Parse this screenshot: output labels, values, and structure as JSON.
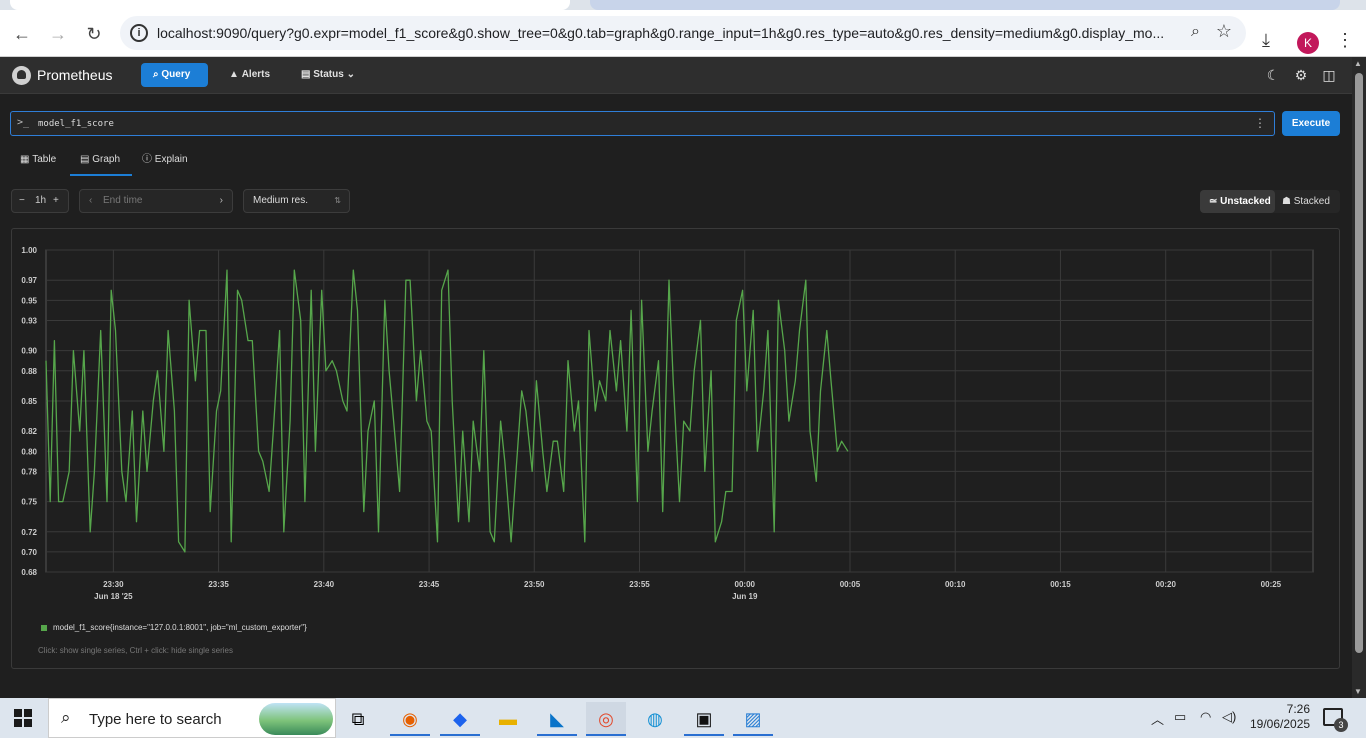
{
  "browser": {
    "url": "localhost:9090/query?g0.expr=model_f1_score&g0.show_tree=0&g0.tab=graph&g0.range_input=1h&g0.res_type=auto&g0.res_density=medium&g0.display_mo...",
    "profile_initial": "K"
  },
  "header": {
    "brand": "Prometheus",
    "nav": {
      "query": "Query",
      "alerts": "Alerts",
      "status": "Status"
    }
  },
  "query": {
    "prompt": ">_",
    "expression": "model_f1_score",
    "execute_label": "Execute"
  },
  "tabs": [
    {
      "label": "Table",
      "icon": "table-icon",
      "active": false
    },
    {
      "label": "Graph",
      "icon": "graph-icon",
      "active": true
    },
    {
      "label": "Explain",
      "icon": "info-icon",
      "active": false
    }
  ],
  "controls": {
    "range": "1h",
    "end_time_placeholder": "End time",
    "resolution": "Medium res.",
    "unstacked": "Unstacked",
    "stacked": "Stacked"
  },
  "chart_data": {
    "type": "line",
    "y_ticks": [
      "0.68",
      "0.70",
      "0.72",
      "0.75",
      "0.78",
      "0.80",
      "0.82",
      "0.85",
      "0.88",
      "0.90",
      "0.93",
      "0.95",
      "0.97",
      "1.00"
    ],
    "x_ticks": [
      {
        "label": "23:30",
        "sub": "Jun 18 '25"
      },
      {
        "label": "23:35",
        "sub": ""
      },
      {
        "label": "23:40",
        "sub": ""
      },
      {
        "label": "23:45",
        "sub": ""
      },
      {
        "label": "23:50",
        "sub": ""
      },
      {
        "label": "23:55",
        "sub": ""
      },
      {
        "label": "00:00",
        "sub": "Jun 19"
      },
      {
        "label": "00:05",
        "sub": ""
      },
      {
        "label": "00:10",
        "sub": ""
      },
      {
        "label": "00:15",
        "sub": ""
      },
      {
        "label": "00:20",
        "sub": ""
      },
      {
        "label": "00:25",
        "sub": ""
      }
    ],
    "ylim": [
      0.68,
      1.0
    ],
    "x_range_minutes_from_2330": [
      -3.2,
      57.0
    ],
    "series": [
      {
        "name": "model_f1_score{instance=\"127.0.0.1:8001\", job=\"ml_custom_exporter\"}",
        "color": "#56a64b",
        "x_minutes_from_2330": [
          -3.2,
          -3.0,
          -2.8,
          -2.6,
          -2.4,
          -2.1,
          -1.9,
          -1.6,
          -1.4,
          -1.1,
          -0.9,
          -0.6,
          -0.3,
          -0.1,
          0.1,
          0.4,
          0.6,
          0.9,
          1.1,
          1.4,
          1.6,
          1.9,
          2.1,
          2.4,
          2.6,
          2.9,
          3.1,
          3.4,
          3.6,
          3.9,
          4.1,
          4.4,
          4.6,
          4.9,
          5.1,
          5.4,
          5.6,
          5.9,
          6.1,
          6.4,
          6.6,
          6.9,
          7.1,
          7.4,
          7.6,
          7.9,
          8.1,
          8.4,
          8.6,
          8.9,
          9.1,
          9.4,
          9.6,
          9.9,
          10.1,
          10.4,
          10.6,
          10.9,
          11.1,
          11.4,
          11.6,
          11.9,
          12.1,
          12.4,
          12.6,
          12.9,
          13.1,
          13.4,
          13.6,
          13.9,
          14.1,
          14.4,
          14.6,
          14.9,
          15.1,
          15.4,
          15.6,
          15.9,
          16.1,
          16.4,
          16.6,
          16.9,
          17.1,
          17.4,
          17.6,
          17.9,
          18.1,
          18.4,
          18.6,
          18.9,
          19.1,
          19.4,
          19.6,
          19.9,
          20.1,
          20.4,
          20.6,
          20.9,
          21.1,
          21.4,
          21.6,
          21.9,
          22.1,
          22.4,
          22.6,
          22.9,
          23.1,
          23.4,
          23.6,
          23.9,
          24.1,
          24.4,
          24.6,
          24.9,
          25.1,
          25.4,
          25.6,
          25.9,
          26.1,
          26.4,
          26.6,
          26.9,
          27.1,
          27.4,
          27.6,
          27.9,
          28.1,
          28.4,
          28.6,
          28.9,
          29.1,
          29.4,
          29.6,
          29.9,
          30.1,
          30.4,
          30.6,
          30.9,
          31.1,
          31.4,
          31.6,
          31.9,
          32.1,
          32.4,
          32.6,
          32.9,
          33.1,
          33.4,
          33.6,
          33.9,
          34.1,
          34.4,
          34.6,
          34.9
        ],
        "values": [
          0.89,
          0.75,
          0.91,
          0.75,
          0.75,
          0.78,
          0.9,
          0.82,
          0.9,
          0.72,
          0.78,
          0.92,
          0.75,
          0.96,
          0.92,
          0.78,
          0.75,
          0.84,
          0.73,
          0.84,
          0.78,
          0.85,
          0.88,
          0.8,
          0.92,
          0.84,
          0.71,
          0.7,
          0.95,
          0.87,
          0.92,
          0.92,
          0.74,
          0.84,
          0.86,
          0.98,
          0.71,
          0.96,
          0.95,
          0.91,
          0.91,
          0.8,
          0.79,
          0.76,
          0.82,
          0.92,
          0.72,
          0.83,
          0.98,
          0.93,
          0.75,
          0.96,
          0.8,
          0.96,
          0.88,
          0.89,
          0.88,
          0.85,
          0.84,
          0.98,
          0.94,
          0.74,
          0.82,
          0.85,
          0.72,
          0.95,
          0.88,
          0.81,
          0.76,
          0.97,
          0.97,
          0.85,
          0.9,
          0.83,
          0.82,
          0.71,
          0.96,
          0.98,
          0.85,
          0.73,
          0.82,
          0.73,
          0.83,
          0.78,
          0.9,
          0.72,
          0.71,
          0.83,
          0.79,
          0.71,
          0.77,
          0.86,
          0.84,
          0.78,
          0.87,
          0.8,
          0.76,
          0.81,
          0.81,
          0.76,
          0.89,
          0.82,
          0.85,
          0.71,
          0.92,
          0.84,
          0.87,
          0.85,
          0.92,
          0.86,
          0.91,
          0.82,
          0.94,
          0.75,
          0.95,
          0.8,
          0.84,
          0.89,
          0.74,
          0.97,
          0.87,
          0.75,
          0.83,
          0.82,
          0.88,
          0.93,
          0.78,
          0.88,
          0.71,
          0.73,
          0.76,
          0.76,
          0.93,
          0.96,
          0.86,
          0.94,
          0.8,
          0.86,
          0.92,
          0.72,
          0.95,
          0.9,
          0.83,
          0.87,
          0.92,
          0.97,
          0.82,
          0.77,
          0.86,
          0.92,
          0.87,
          0.8,
          0.81,
          0.8
        ]
      }
    ],
    "legend_hint": "Click: show single series, Ctrl + click: hide single series",
    "grid": true
  },
  "taskbar": {
    "search_placeholder": "Type here to search",
    "time": "7:26",
    "date": "19/06/2025",
    "notifications": "3"
  }
}
